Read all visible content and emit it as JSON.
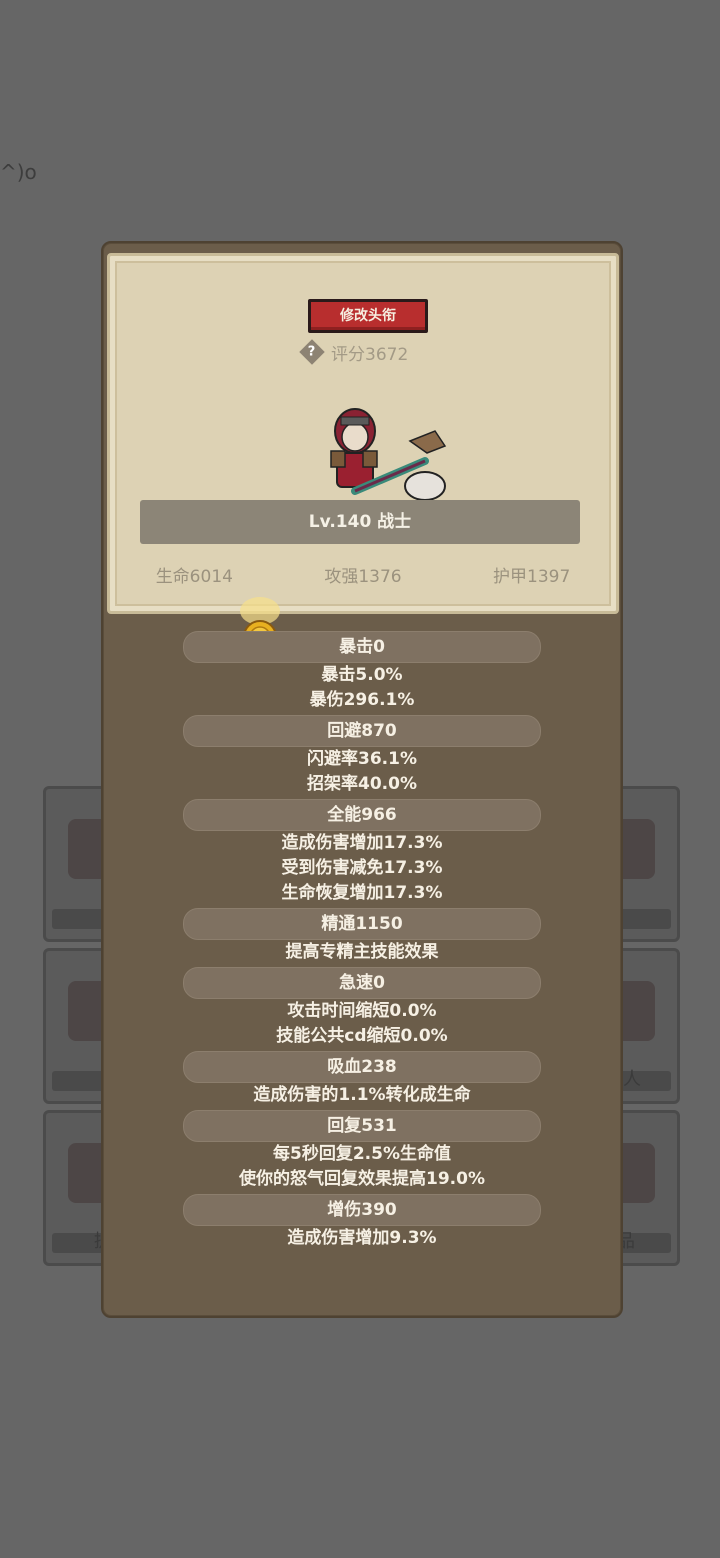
{
  "background": {
    "scribble": "^)o",
    "card_texts": [
      "人",
      "品",
      "提"
    ]
  },
  "panel": {
    "rename_button": "修改头衔",
    "help_icon": "?",
    "score": "评分3672",
    "level_class": "Lv.140 战士",
    "main_stats": [
      "生命6014",
      "攻强1376",
      "护甲1397"
    ]
  },
  "stats": [
    {
      "title": "暴击0",
      "lines": [
        "暴击5.0%",
        "暴伤296.1%"
      ]
    },
    {
      "title": "回避870",
      "lines": [
        "闪避率36.1%",
        "招架率40.0%"
      ]
    },
    {
      "title": "全能966",
      "lines": [
        "造成伤害增加17.3%",
        "受到伤害减免17.3%",
        "生命恢复增加17.3%"
      ]
    },
    {
      "title": "精通1150",
      "lines": [
        "提高专精主技能效果"
      ]
    },
    {
      "title": "急速0",
      "lines": [
        "攻击时间缩短0.0%",
        "技能公共cd缩短0.0%"
      ]
    },
    {
      "title": "吸血238",
      "lines": [
        "造成伤害的1.1%转化成生命"
      ]
    },
    {
      "title": "回复531",
      "lines": [
        "每5秒回复2.5%生命值",
        "使你的怒气回复效果提高19.0%"
      ]
    },
    {
      "title": "增伤390",
      "lines": [
        "造成伤害增加9.3%"
      ]
    }
  ]
}
